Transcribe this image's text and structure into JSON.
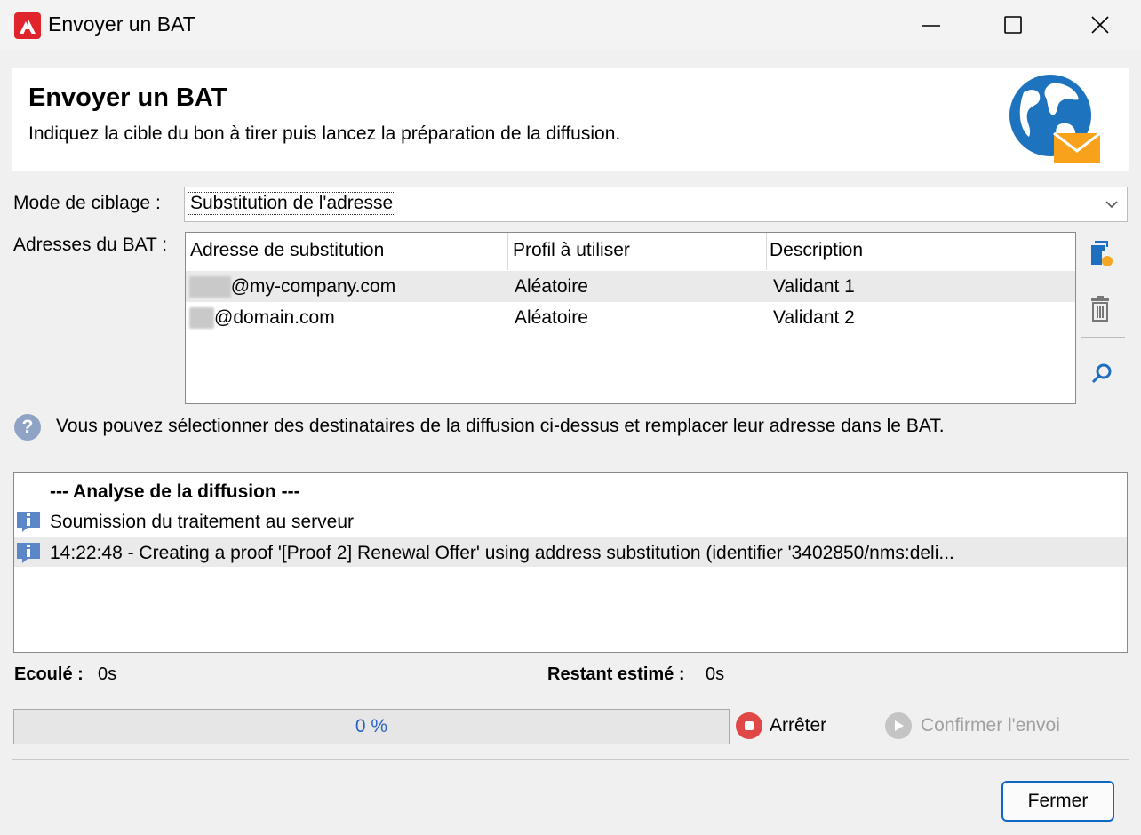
{
  "window": {
    "title": "Envoyer un BAT"
  },
  "header": {
    "title": "Envoyer un BAT",
    "subtitle": "Indiquez la cible du bon à tirer puis lancez la préparation de la diffusion."
  },
  "targeting": {
    "label": "Mode de ciblage :",
    "value": "Substitution de l'adresse"
  },
  "proof_addresses": {
    "label": "Adresses du BAT :",
    "columns": [
      "Adresse de substitution",
      "Profil à utiliser",
      "Description"
    ],
    "rows": [
      {
        "address_blurred": "anna",
        "address_domain": "@my-company.com",
        "profile": "Aléatoire",
        "description": "Validant 1"
      },
      {
        "address_blurred": "joe",
        "address_domain": "@domain.com",
        "profile": "Aléatoire",
        "description": "Validant 2"
      }
    ]
  },
  "help_text": "Vous pouvez sélectionner des destinataires de la diffusion ci-dessus et remplacer leur adresse dans le BAT.",
  "log": {
    "heading": "--- Analyse de la diffusion ---",
    "lines": [
      "Soumission du traitement au serveur",
      "14:22:48 - Creating a proof '[Proof 2] Renewal Offer' using address substitution (identifier '3402850/nms:deli..."
    ]
  },
  "timing": {
    "elapsed_label": "Ecoulé :",
    "elapsed_value": "0s",
    "remaining_label": "Restant estimé :",
    "remaining_value": "0s"
  },
  "progress": {
    "percent": 0,
    "text": "0 %"
  },
  "buttons": {
    "stop": "Arrêter",
    "confirm": "Confirmer l'envoi",
    "close": "Fermer"
  },
  "colors": {
    "accent": "#0f67c4",
    "stop": "#e04848",
    "disabled": "#a0a0a0",
    "progress_text": "#2962c6"
  }
}
